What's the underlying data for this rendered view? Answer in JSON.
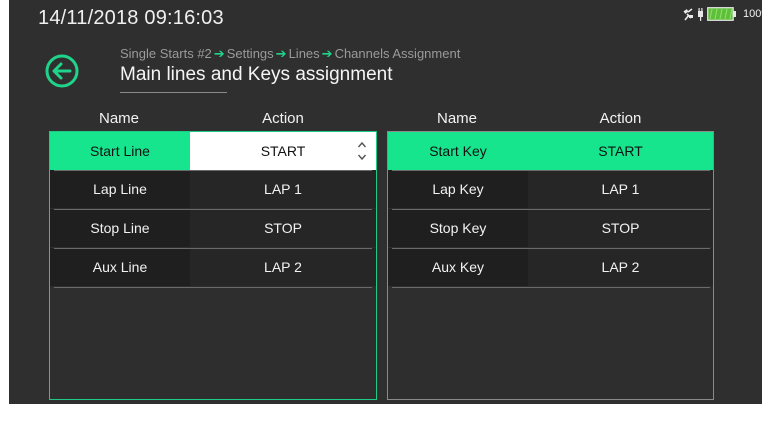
{
  "status_bar": {
    "datetime": "14/11/2018  09:16:03",
    "battery_percent": "100%",
    "icons": [
      "satellite-icon",
      "plug-icon",
      "battery-icon"
    ],
    "accent_color": "#1fd38a"
  },
  "header": {
    "breadcrumb": [
      "Single Starts #2",
      "Settings",
      "Lines",
      "Channels Assignment"
    ],
    "title": "Main lines and Keys assignment",
    "back_icon": "back-arrow-icon"
  },
  "lines_table": {
    "col_name": "Name",
    "col_action": "Action",
    "rows": [
      {
        "name": "Start Line",
        "action": "START"
      },
      {
        "name": "Lap Line",
        "action": "LAP 1"
      },
      {
        "name": "Stop Line",
        "action": "STOP"
      },
      {
        "name": "Aux Line",
        "action": "LAP 2"
      }
    ],
    "selected_row": 0,
    "editing": true
  },
  "keys_table": {
    "col_name": "Name",
    "col_action": "Action",
    "rows": [
      {
        "name": "Start Key",
        "action": "START"
      },
      {
        "name": "Lap Key",
        "action": "LAP 1"
      },
      {
        "name": "Stop Key",
        "action": "STOP"
      },
      {
        "name": "Aux Key",
        "action": "LAP 2"
      }
    ],
    "selected_row": 0
  }
}
